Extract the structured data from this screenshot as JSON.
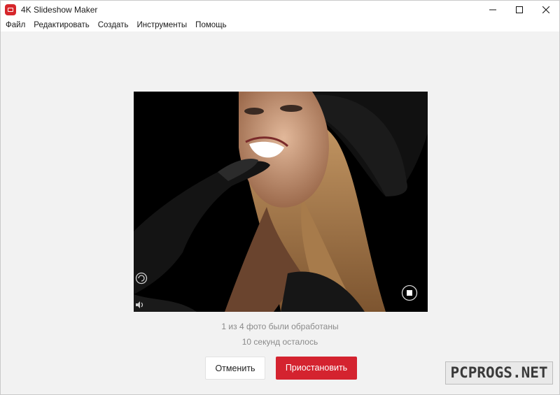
{
  "window": {
    "title": "4K Slideshow Maker",
    "app_icon": "slideshow-app-icon",
    "controls": [
      "minimize-icon",
      "maximize-icon",
      "close-icon"
    ]
  },
  "menu": {
    "items": [
      "Файл",
      "Редактировать",
      "Создать",
      "Инструменты",
      "Помощь"
    ]
  },
  "preview": {
    "image": "photo-woman-black-glove-and-hat",
    "overlay_icons": [
      "rotate-icon",
      "audio-icon",
      "stop-icon"
    ]
  },
  "status": {
    "progress_text": "1 из 4 фото были обработаны",
    "time_left": "10 секунд осталось"
  },
  "buttons": {
    "cancel": "Отменить",
    "pause": "Приостановить"
  },
  "colors": {
    "accent": "#d4232f",
    "background": "#f2f2f2"
  },
  "watermark": "PCPROGS.NET"
}
